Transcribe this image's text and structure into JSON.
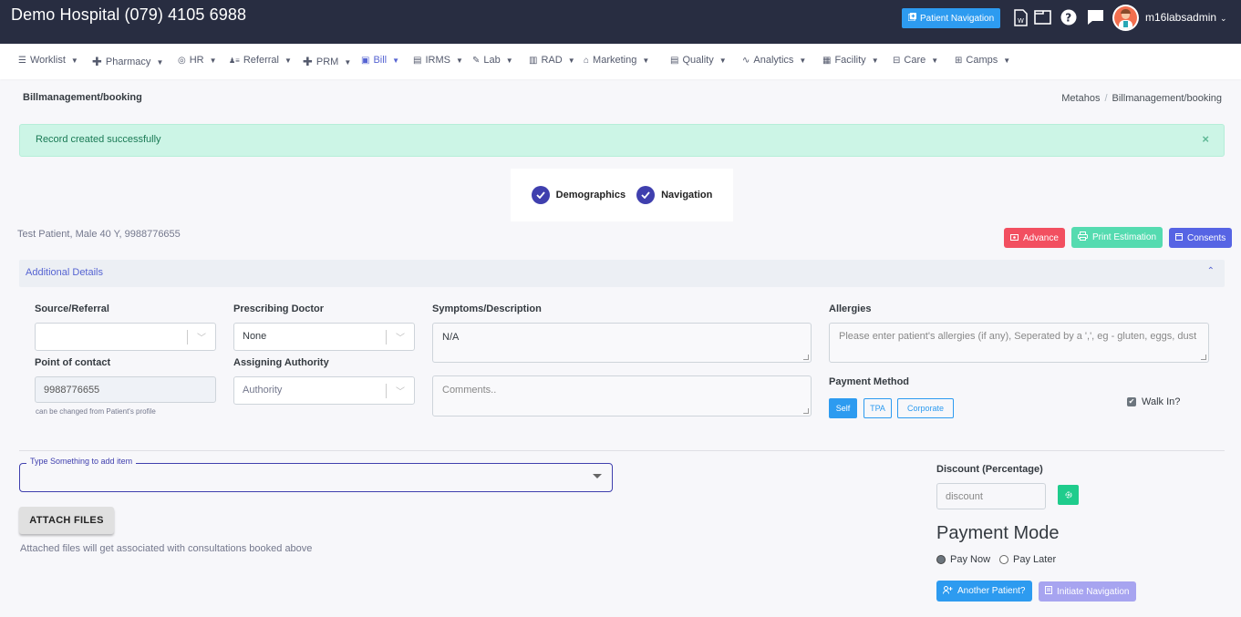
{
  "header": {
    "title": "Demo Hospital (079) 4105 6988",
    "patient_navigation_label": "Patient Navigation",
    "icons": [
      "word-doc-icon",
      "window-icon",
      "help-icon",
      "chat-icon"
    ],
    "username": "m16labsadmin"
  },
  "nav": {
    "items": [
      {
        "label": "Worklist",
        "icon": "list-icon"
      },
      {
        "label": "Pharmacy",
        "icon": "plus-icon"
      },
      {
        "label": "HR",
        "icon": "at-icon"
      },
      {
        "label": "Referral",
        "icon": "user-list-icon"
      },
      {
        "label": "PRM",
        "icon": "plus-icon"
      },
      {
        "label": "Bill",
        "icon": "bill-icon",
        "active": true
      },
      {
        "label": "IRMS",
        "icon": "id-card-icon"
      },
      {
        "label": "Lab",
        "icon": "pipette-icon"
      },
      {
        "label": "RAD",
        "icon": "book-icon"
      },
      {
        "label": "Marketing",
        "icon": "bag-icon"
      },
      {
        "label": "Quality",
        "icon": "chart-box-icon"
      },
      {
        "label": "Analytics",
        "icon": "pulse-icon"
      },
      {
        "label": "Facility",
        "icon": "building-icon"
      },
      {
        "label": "Care",
        "icon": "bed-icon"
      },
      {
        "label": "Camps",
        "icon": "kit-icon"
      }
    ]
  },
  "page": {
    "title": "Billmanagement/booking",
    "breadcrumb": [
      "Metahos",
      "Billmanagement/booking"
    ]
  },
  "alert": {
    "message": "Record created successfully",
    "close": "×"
  },
  "stepper": {
    "steps": [
      {
        "label": "Demographics",
        "done": true
      },
      {
        "label": "Navigation",
        "done": true
      }
    ]
  },
  "patient": {
    "summary": "Test Patient, Male 40 Y, 9988776655"
  },
  "actions": {
    "advance": "Advance",
    "print_estimation": "Print Estimation",
    "consents": "Consents"
  },
  "additional_details": {
    "title": "Additional Details",
    "expanded": true,
    "source_referral": {
      "label": "Source/Referral",
      "value": ""
    },
    "prescribing_doctor": {
      "label": "Prescribing Doctor",
      "value": "None"
    },
    "point_of_contact": {
      "label": "Point of contact",
      "value": "9988776655",
      "hint": "can be changed from Patient's profile"
    },
    "assigning_authority": {
      "label": "Assigning Authority",
      "placeholder": "Authority"
    },
    "symptoms": {
      "label": "Symptoms/Description",
      "value": "N/A"
    },
    "comments": {
      "placeholder": "Comments.."
    },
    "allergies": {
      "label": "Allergies",
      "placeholder": "Please enter patient's allergies (if any), Seperated by a ',', eg - gluten, eggs, dust"
    },
    "payment_method": {
      "label": "Payment Method",
      "options": [
        "Self",
        "TPA",
        "Corporate"
      ],
      "selected": "Self"
    },
    "walk_in": {
      "label": "Walk In?",
      "checked": true
    }
  },
  "items": {
    "search_label": "Type Something to add item",
    "attach_label": "ATTACH FILES",
    "attach_hint": "Attached files will get associated with consultations booked above"
  },
  "discount": {
    "label": "Discount (Percentage)",
    "placeholder": "discount"
  },
  "payment_mode": {
    "title": "Payment Mode",
    "options": [
      "Pay Now",
      "Pay Later"
    ],
    "selected": "Pay Now"
  },
  "footer_actions": {
    "another_patient": "Another Patient?",
    "initiate_navigation": "Initiate Navigation"
  },
  "colors": {
    "topbar": "#282d41",
    "primary": "#5664d2",
    "info": "#2d9bf0",
    "danger": "#f24f60",
    "success": "#55dbb0",
    "stepper": "#3f3fae"
  }
}
